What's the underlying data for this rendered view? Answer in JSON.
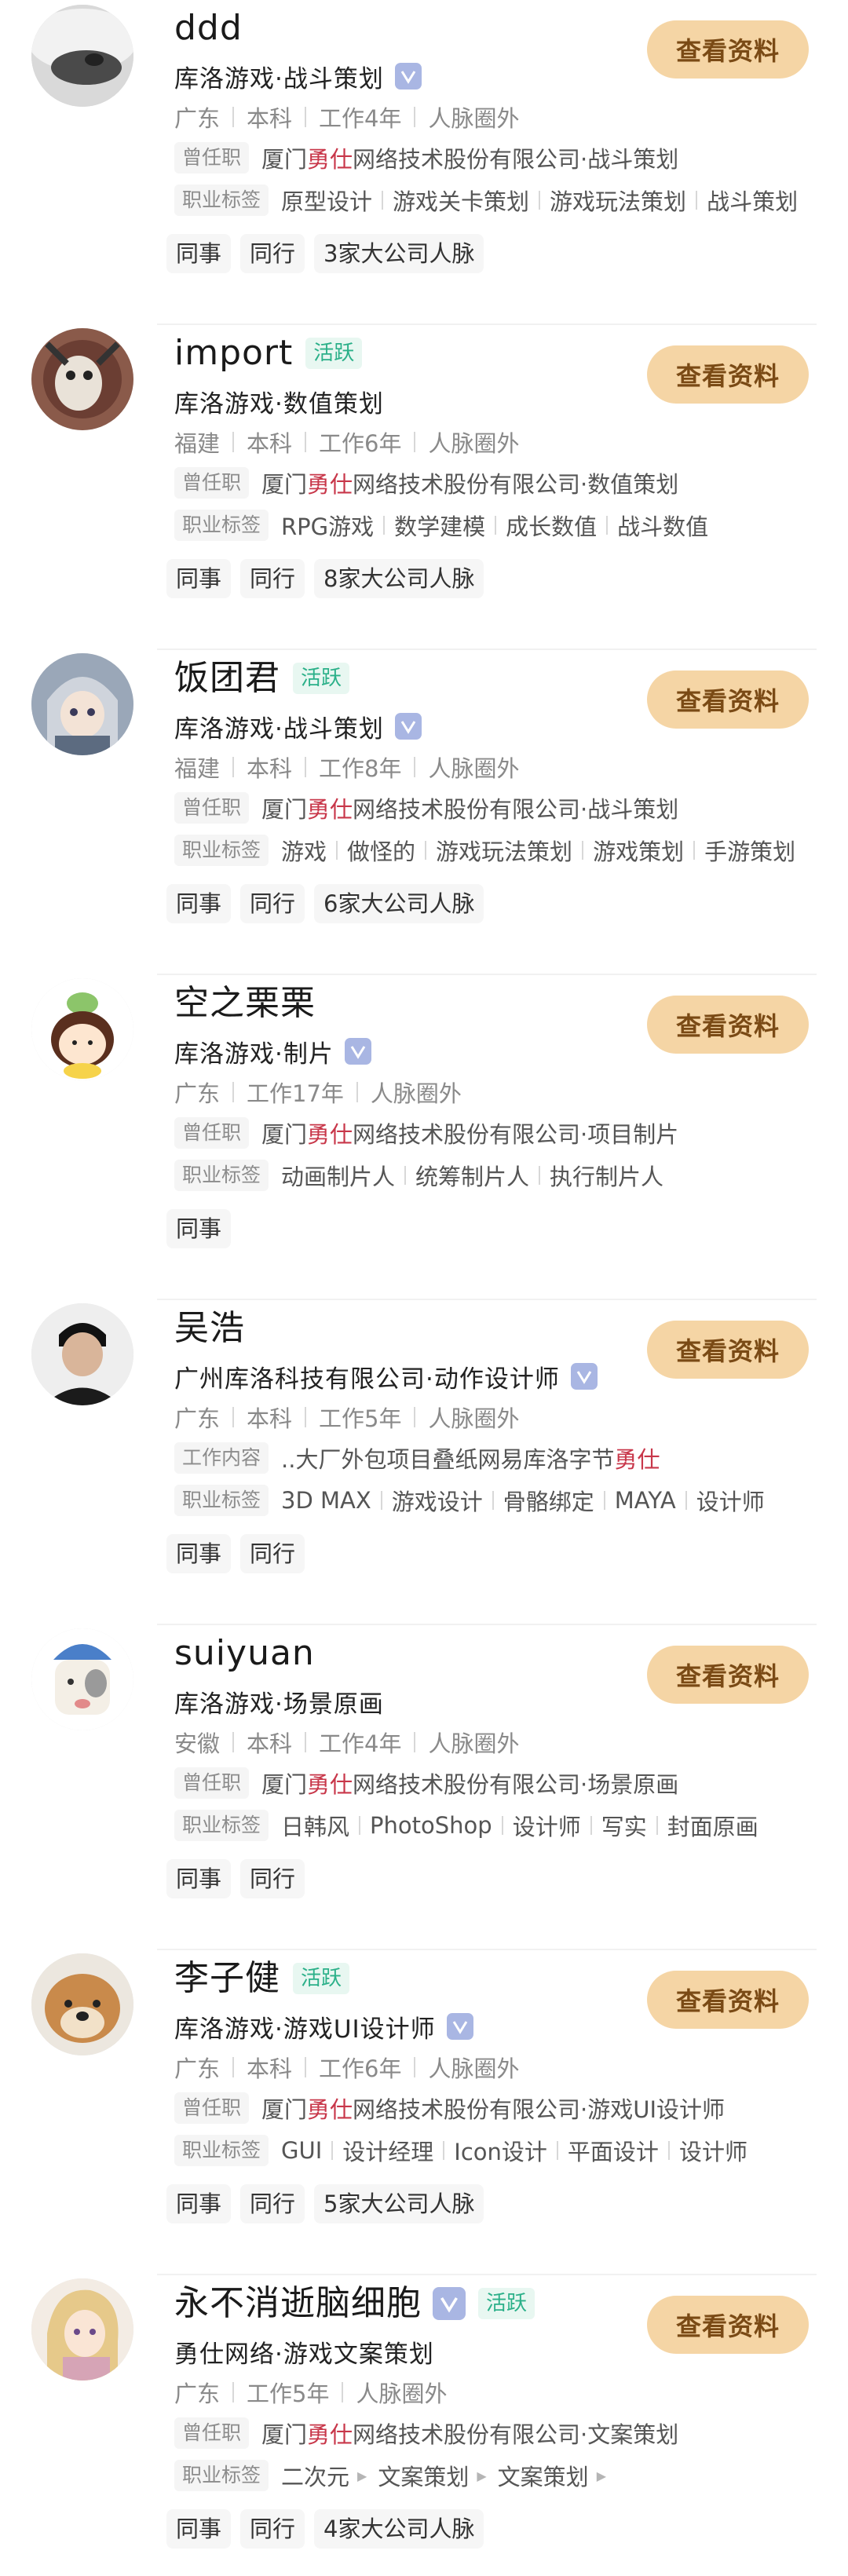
{
  "button_label": "查看资料",
  "active_label": "活跃",
  "cards": [
    {
      "name": "ddd",
      "company": "库洛游戏·战斗策划",
      "facts": [
        "广东",
        "本科",
        "工作4年",
        "人脉圈外"
      ],
      "info_label": "曾任职",
      "info_pre": "厦门",
      "info_hl": "勇仕",
      "info_post": "网络技术股份有限公司·战斗策划",
      "tags_label": "职业标签",
      "tags": [
        "原型设计",
        "游戏关卡策划",
        "游戏玩法策划",
        "战斗策划"
      ],
      "chips": [
        "同事",
        "同行",
        "3家大公司人脉"
      ]
    },
    {
      "name": "import",
      "company": "库洛游戏·数值策划",
      "facts": [
        "福建",
        "本科",
        "工作6年",
        "人脉圈外"
      ],
      "info_label": "曾任职",
      "info_pre": "厦门",
      "info_hl": "勇仕",
      "info_post": "网络技术股份有限公司·数值策划",
      "tags_label": "职业标签",
      "tags": [
        "RPG游戏",
        "数学建模",
        "成长数值",
        "战斗数值"
      ],
      "chips": [
        "同事",
        "同行",
        "8家大公司人脉"
      ]
    },
    {
      "name": "饭团君",
      "company": "库洛游戏·战斗策划",
      "facts": [
        "福建",
        "本科",
        "工作8年",
        "人脉圈外"
      ],
      "info_label": "曾任职",
      "info_pre": "厦门",
      "info_hl": "勇仕",
      "info_post": "网络技术股份有限公司·战斗策划",
      "tags_label": "职业标签",
      "tags": [
        "游戏",
        "做怪的",
        "游戏玩法策划",
        "游戏策划",
        "手游策划"
      ],
      "chips": [
        "同事",
        "同行",
        "6家大公司人脉"
      ]
    },
    {
      "name": "空之栗栗",
      "company": "库洛游戏·制片",
      "facts": [
        "广东",
        "工作17年",
        "人脉圈外"
      ],
      "info_label": "曾任职",
      "info_pre": "厦门",
      "info_hl": "勇仕",
      "info_post": "网络技术股份有限公司·项目制片",
      "tags_label": "职业标签",
      "tags": [
        "动画制片人",
        "统筹制片人",
        "执行制片人"
      ],
      "chips": [
        "同事"
      ]
    },
    {
      "name": "吴浩",
      "company": "广州库洛科技有限公司·动作设计师",
      "facts": [
        "广东",
        "本科",
        "工作5年",
        "人脉圈外"
      ],
      "info_label": "工作内容",
      "info_pre": "..大厂外包项目叠纸网易库洛字节",
      "info_hl": "勇仕",
      "info_post": "",
      "tags_label": "职业标签",
      "tags": [
        "3D MAX",
        "游戏设计",
        "骨骼绑定",
        "MAYA",
        "设计师"
      ],
      "chips": [
        "同事",
        "同行"
      ]
    },
    {
      "name": "suiyuan",
      "company": "库洛游戏·场景原画",
      "facts": [
        "安徽",
        "本科",
        "工作4年",
        "人脉圈外"
      ],
      "info_label": "曾任职",
      "info_pre": "厦门",
      "info_hl": "勇仕",
      "info_post": "网络技术股份有限公司·场景原画",
      "tags_label": "职业标签",
      "tags": [
        "日韩风",
        "PhotoShop",
        "设计师",
        "写实",
        "封面原画"
      ],
      "chips": [
        "同事",
        "同行"
      ]
    },
    {
      "name": "李子健",
      "company": "库洛游戏·游戏UI设计师",
      "facts": [
        "广东",
        "本科",
        "工作6年",
        "人脉圈外"
      ],
      "info_label": "曾任职",
      "info_pre": "厦门",
      "info_hl": "勇仕",
      "info_post": "网络技术股份有限公司·游戏UI设计师",
      "tags_label": "职业标签",
      "tags": [
        "GUI",
        "设计经理",
        "Icon设计",
        "平面设计",
        "设计师"
      ],
      "chips": [
        "同事",
        "同行",
        "5家大公司人脉"
      ]
    },
    {
      "name": "永不消逝脑细胞",
      "company": "勇仕网络·游戏文案策划",
      "facts": [
        "广东",
        "工作5年",
        "人脉圈外"
      ],
      "info_label": "曾任职",
      "info_pre": "厦门",
      "info_hl": "勇仕",
      "info_post": "网络技术股份有限公司·文案策划",
      "tags_label": "职业标签",
      "tags": [
        "二次元",
        "文案策划",
        "文案策划"
      ],
      "chips": [
        "同事",
        "同行",
        "4家大公司人脉"
      ]
    }
  ]
}
